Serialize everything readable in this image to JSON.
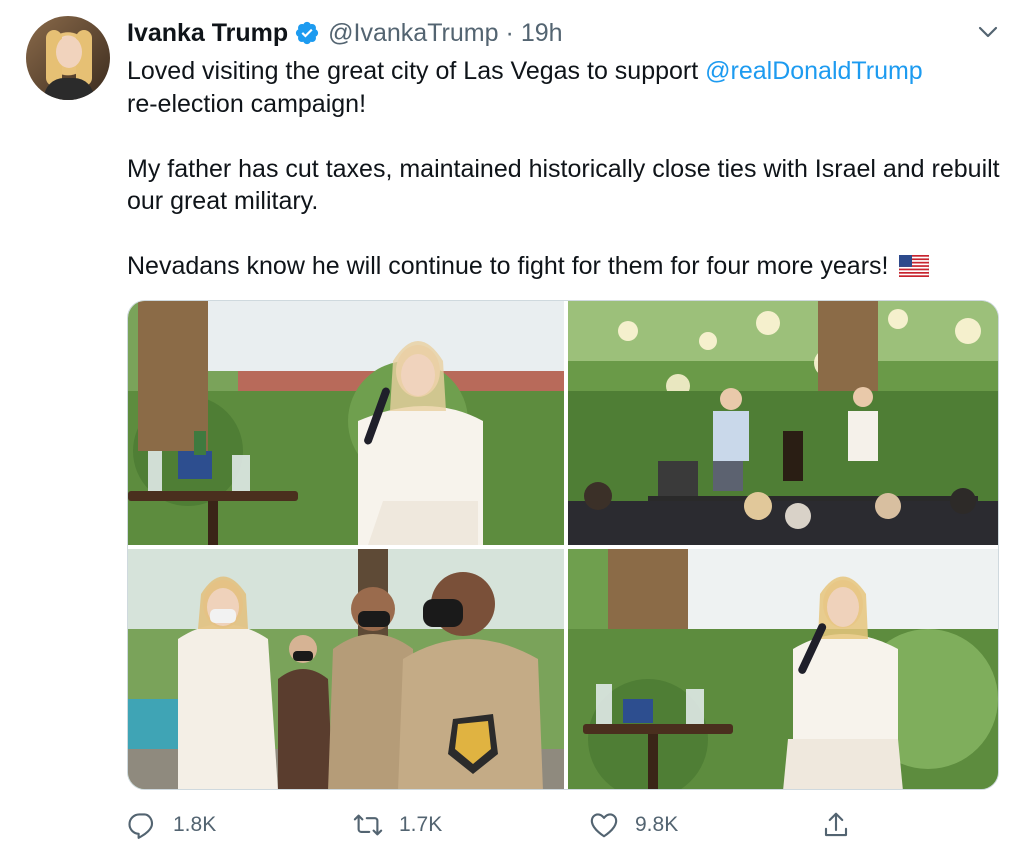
{
  "tweet": {
    "author": {
      "display_name": "Ivanka Trump",
      "handle": "@IvankaTrump",
      "verified": true,
      "time": "19h",
      "separator": "·"
    },
    "text": {
      "line1_before": "Loved visiting the great city of Las Vegas to support ",
      "mention": "@realDonaldTrump",
      "line1_after": "re-election campaign!",
      "paragraph2": "My father has cut taxes, maintained historically close ties with Israel and rebuilt our great military.",
      "paragraph3": "Nevadans know he will continue to fight for them for four more years! ",
      "emoji": "us-flag"
    },
    "media_count": 4,
    "actions": {
      "replies": "1.8K",
      "retweets": "1.7K",
      "likes": "9.8K"
    },
    "icons": {
      "verified": "verified-badge-icon",
      "more": "chevron-down-icon",
      "reply": "reply-icon",
      "retweet": "retweet-icon",
      "like": "heart-icon",
      "share": "share-icon"
    },
    "colors": {
      "text": "#0f1419",
      "secondary": "#536471",
      "link": "#1d9bf0",
      "border": "#cfd9de"
    }
  }
}
